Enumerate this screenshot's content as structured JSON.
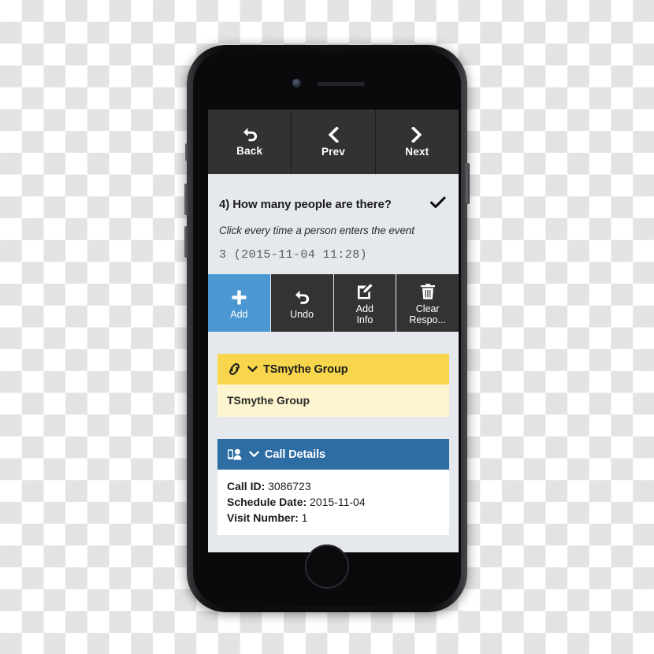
{
  "device": {
    "type": "smartphone",
    "camera": "front-camera",
    "speaker": "earpiece-speaker",
    "home_button": "home-button"
  },
  "navbar": {
    "buttons": [
      {
        "label": "Back",
        "icon": "undo-arrow-icon"
      },
      {
        "label": "Prev",
        "icon": "chevron-left-icon"
      },
      {
        "label": "Next",
        "icon": "chevron-right-icon"
      }
    ]
  },
  "question": {
    "text": "4) How many people are there?",
    "status_icon": "checkmark-icon",
    "instruction": "Click every time a person enters the event",
    "response_value": "3 (2015-11-04 11:28)"
  },
  "actions": [
    {
      "label": "Add",
      "icon": "plus-icon",
      "style": "primary"
    },
    {
      "label": "Undo",
      "icon": "undo-arrow-icon",
      "style": "default"
    },
    {
      "label1": "Add",
      "label2": "Info",
      "icon": "edit-note-icon",
      "style": "default"
    },
    {
      "label1": "Clear",
      "label2": "Respo...",
      "icon": "trash-icon",
      "style": "default"
    }
  ],
  "panels": {
    "group": {
      "title": "TSmythe Group",
      "icon": "link-chain-icon",
      "chevron": "chevron-down-icon",
      "body_text": "TSmythe Group"
    },
    "call_details": {
      "title": "Call Details",
      "icon": "phone-person-icon",
      "chevron": "chevron-down-icon",
      "rows": [
        {
          "label": "Call ID:",
          "value": "3086723"
        },
        {
          "label": "Schedule Date:",
          "value": "2015-11-04"
        },
        {
          "label": "Visit Number:",
          "value": "1"
        }
      ]
    }
  },
  "colors": {
    "primary_blue": "#4a97d2",
    "panel_blue": "#2e6da4",
    "panel_yellow": "#f7d64e",
    "panel_yellow_light": "#fdf5cf",
    "dark_button": "#333333",
    "nav_bar": "#323232",
    "screen_bg": "#e5e8ed"
  }
}
